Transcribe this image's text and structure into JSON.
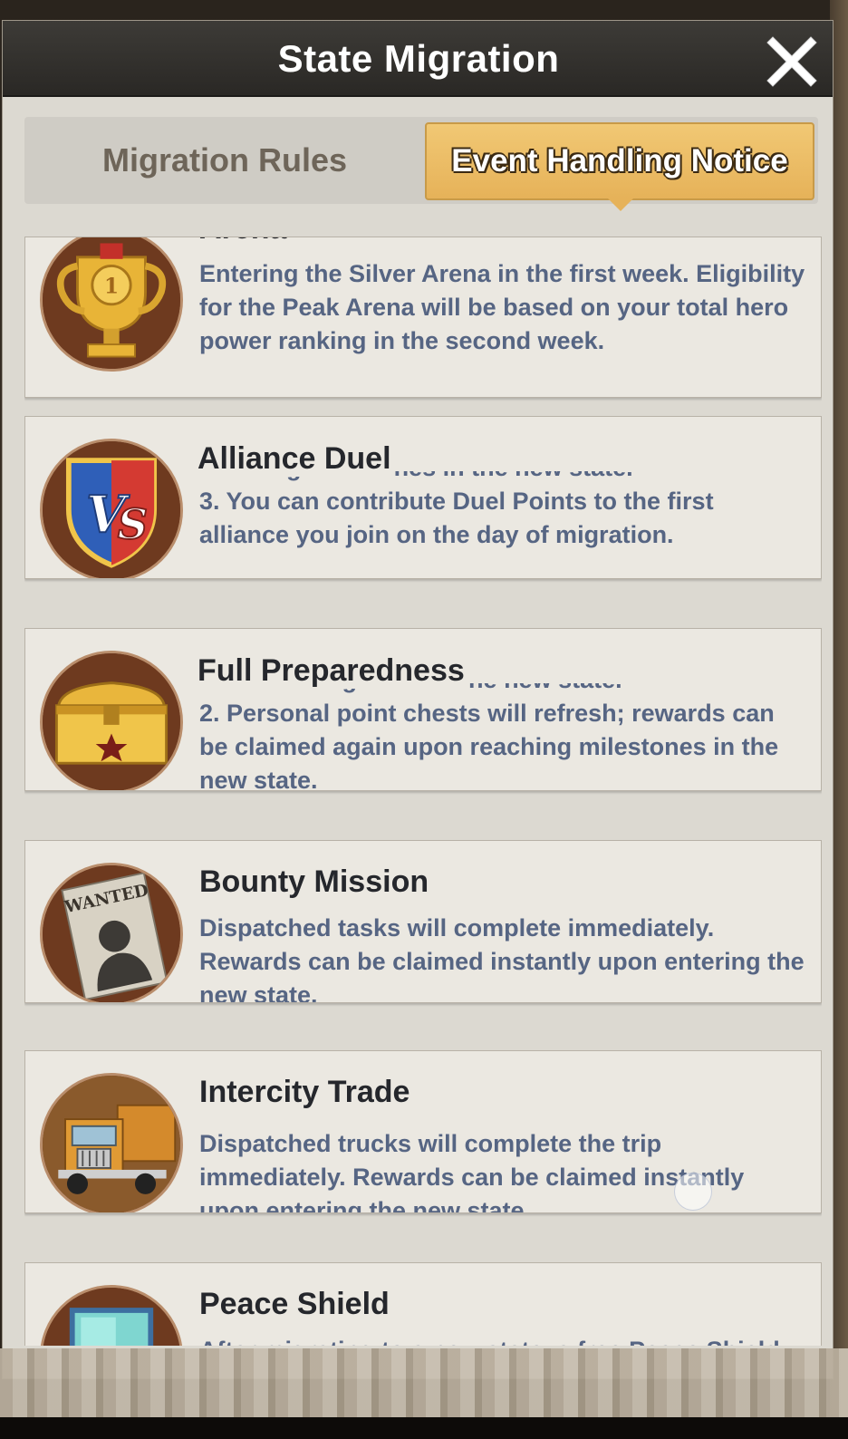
{
  "dialog": {
    "title": "State Migration",
    "close_icon": "close-x-icon"
  },
  "tabs": [
    {
      "label": "Migration Rules",
      "selected": false
    },
    {
      "label": "Event Handling Notice",
      "selected": true
    }
  ],
  "accent_color": "#e6b259",
  "events": [
    {
      "title": "Arena",
      "icon": "trophy-icon",
      "body": "Entering the Silver Arena in the first week. Eligibility for the Peak Arena will be based on your total hero power ranking in the second week."
    },
    {
      "title": "Alliance Duel",
      "icon": "vs-shield-icon",
      "body_top": "reaching milestones in the new state.",
      "body": "3. You can contribute Duel Points to the first alliance you join on the day of migration."
    },
    {
      "title": "Full Preparedness",
      "icon": "treasure-chest-icon",
      "body_top": "accumulating anew in the new state.",
      "body": "2. Personal point chests will refresh; rewards can be claimed again upon reaching milestones in the new state."
    },
    {
      "title": "Bounty Mission",
      "icon": "wanted-poster-icon",
      "body": "Dispatched tasks will complete immediately. Rewards can be claimed instantly upon entering the new state."
    },
    {
      "title": "Intercity Trade",
      "icon": "truck-icon",
      "body": "Dispatched trucks will complete the trip immediately. Rewards can be claimed instantly upon entering the new state."
    },
    {
      "title": "Peace Shield",
      "icon": "shield-icon",
      "body": "After migrating to a new state, a free Peace Shield will be granted for the..."
    }
  ]
}
